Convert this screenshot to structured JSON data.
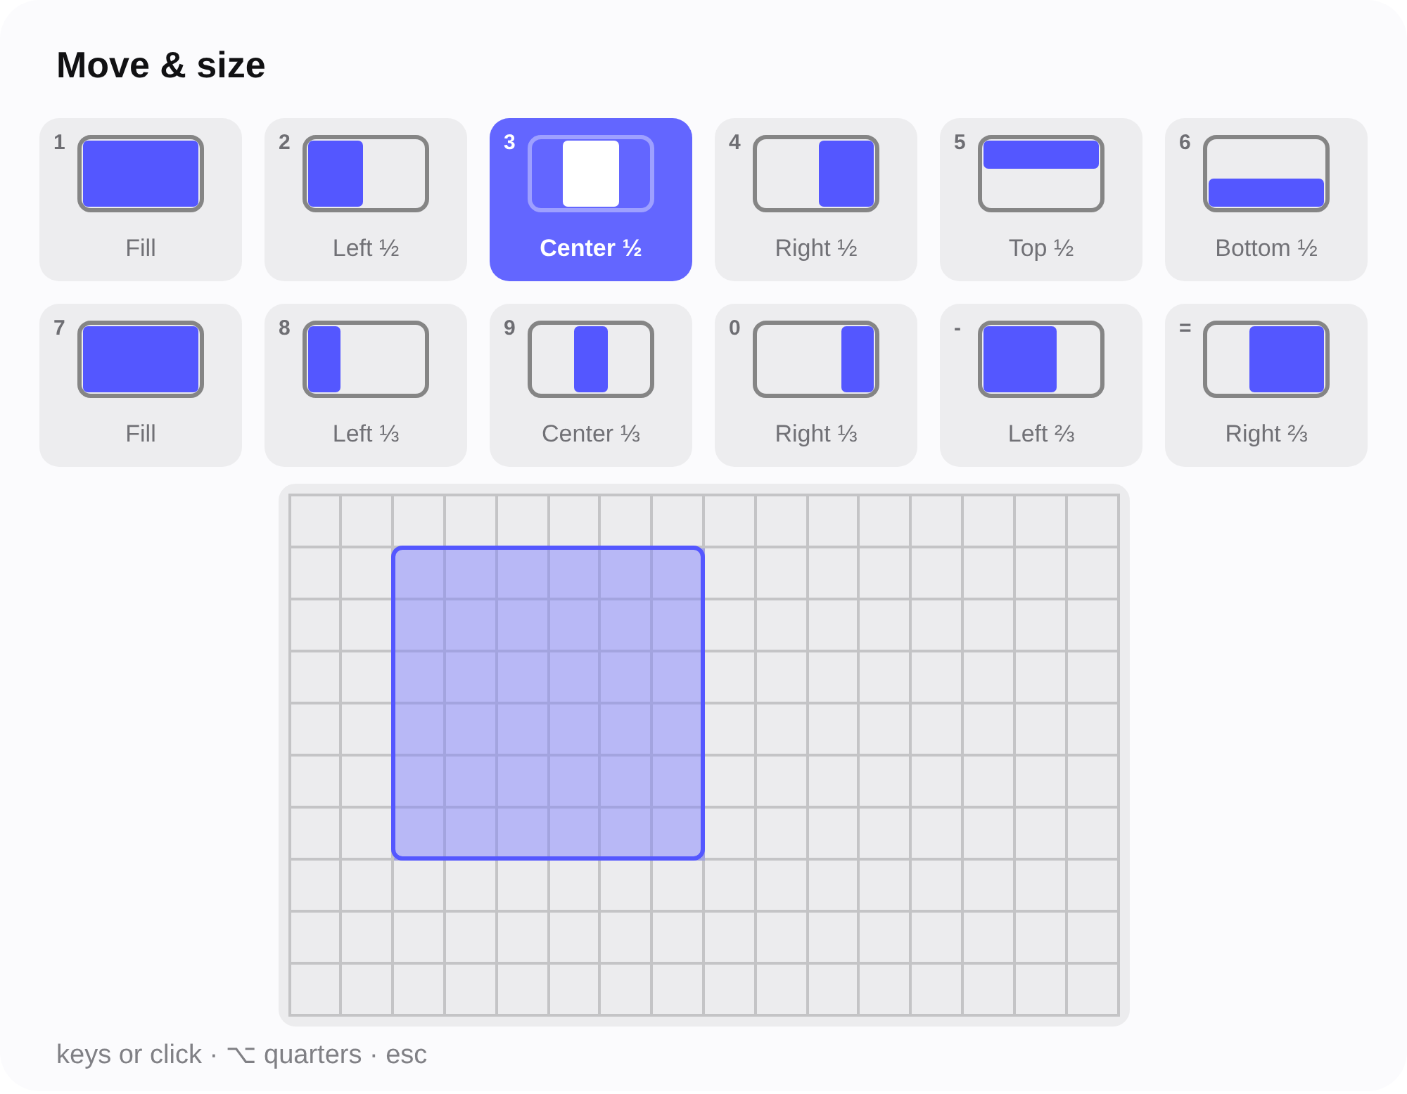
{
  "title": "Move & size",
  "tiles": [
    {
      "key": "1",
      "label": "Fill",
      "kind": "fill",
      "selected": false
    },
    {
      "key": "2",
      "label": "Left ½",
      "kind": "left_half",
      "selected": false
    },
    {
      "key": "3",
      "label": "Center ½",
      "kind": "center_half",
      "selected": true
    },
    {
      "key": "4",
      "label": "Right ½",
      "kind": "right_half",
      "selected": false
    },
    {
      "key": "5",
      "label": "Top ½",
      "kind": "top_half",
      "selected": false
    },
    {
      "key": "6",
      "label": "Bottom ½",
      "kind": "bottom_half",
      "selected": false
    },
    {
      "key": "7",
      "label": "Fill",
      "kind": "fill",
      "selected": false
    },
    {
      "key": "8",
      "label": "Left ⅓",
      "kind": "left_third",
      "selected": false
    },
    {
      "key": "9",
      "label": "Center ⅓",
      "kind": "center_third",
      "selected": false
    },
    {
      "key": "0",
      "label": "Right ⅓",
      "kind": "right_third",
      "selected": false
    },
    {
      "key": "-",
      "label": "Left ⅔",
      "kind": "left_two_thirds",
      "selected": false
    },
    {
      "key": "=",
      "label": "Right ⅔",
      "kind": "right_two_thirds",
      "selected": false
    }
  ],
  "grid": {
    "rows": [
      {
        "cells": [
          {
            "selected": false
          },
          {
            "selected": false
          },
          {
            "selected": false
          },
          {
            "selected": false
          },
          {
            "selected": false
          },
          {
            "selected": false
          },
          {
            "selected": false
          },
          {
            "selected": false
          },
          {
            "selected": false
          },
          {
            "selected": false
          },
          {
            "selected": false
          },
          {
            "selected": false
          },
          {
            "selected": false
          },
          {
            "selected": false
          },
          {
            "selected": false
          },
          {
            "selected": false
          }
        ]
      },
      {
        "cells": [
          {
            "selected": false
          },
          {
            "selected": false
          },
          {
            "selected": true
          },
          {
            "selected": true
          },
          {
            "selected": true
          },
          {
            "selected": true
          },
          {
            "selected": true
          },
          {
            "selected": true
          },
          {
            "selected": false
          },
          {
            "selected": false
          },
          {
            "selected": false
          },
          {
            "selected": false
          },
          {
            "selected": false
          },
          {
            "selected": false
          },
          {
            "selected": false
          },
          {
            "selected": false
          }
        ]
      },
      {
        "cells": [
          {
            "selected": false
          },
          {
            "selected": false
          },
          {
            "selected": true
          },
          {
            "selected": true
          },
          {
            "selected": true
          },
          {
            "selected": true
          },
          {
            "selected": true
          },
          {
            "selected": true
          },
          {
            "selected": false
          },
          {
            "selected": false
          },
          {
            "selected": false
          },
          {
            "selected": false
          },
          {
            "selected": false
          },
          {
            "selected": false
          },
          {
            "selected": false
          },
          {
            "selected": false
          }
        ]
      },
      {
        "cells": [
          {
            "selected": false
          },
          {
            "selected": false
          },
          {
            "selected": true
          },
          {
            "selected": true
          },
          {
            "selected": true
          },
          {
            "selected": true
          },
          {
            "selected": true
          },
          {
            "selected": true
          },
          {
            "selected": false
          },
          {
            "selected": false
          },
          {
            "selected": false
          },
          {
            "selected": false
          },
          {
            "selected": false
          },
          {
            "selected": false
          },
          {
            "selected": false
          },
          {
            "selected": false
          }
        ]
      },
      {
        "cells": [
          {
            "selected": false
          },
          {
            "selected": false
          },
          {
            "selected": true
          },
          {
            "selected": true
          },
          {
            "selected": true
          },
          {
            "selected": true
          },
          {
            "selected": true
          },
          {
            "selected": true
          },
          {
            "selected": false
          },
          {
            "selected": false
          },
          {
            "selected": false
          },
          {
            "selected": false
          },
          {
            "selected": false
          },
          {
            "selected": false
          },
          {
            "selected": false
          },
          {
            "selected": false
          }
        ]
      },
      {
        "cells": [
          {
            "selected": false
          },
          {
            "selected": false
          },
          {
            "selected": true
          },
          {
            "selected": true
          },
          {
            "selected": true
          },
          {
            "selected": true
          },
          {
            "selected": true
          },
          {
            "selected": true
          },
          {
            "selected": false
          },
          {
            "selected": false
          },
          {
            "selected": false
          },
          {
            "selected": false
          },
          {
            "selected": false
          },
          {
            "selected": false
          },
          {
            "selected": false
          },
          {
            "selected": false
          }
        ]
      },
      {
        "cells": [
          {
            "selected": false
          },
          {
            "selected": false
          },
          {
            "selected": true
          },
          {
            "selected": true
          },
          {
            "selected": true
          },
          {
            "selected": true
          },
          {
            "selected": true
          },
          {
            "selected": true
          },
          {
            "selected": false
          },
          {
            "selected": false
          },
          {
            "selected": false
          },
          {
            "selected": false
          },
          {
            "selected": false
          },
          {
            "selected": false
          },
          {
            "selected": false
          },
          {
            "selected": false
          }
        ]
      },
      {
        "cells": [
          {
            "selected": false
          },
          {
            "selected": false
          },
          {
            "selected": false
          },
          {
            "selected": false
          },
          {
            "selected": false
          },
          {
            "selected": false
          },
          {
            "selected": false
          },
          {
            "selected": false
          },
          {
            "selected": false
          },
          {
            "selected": false
          },
          {
            "selected": false
          },
          {
            "selected": false
          },
          {
            "selected": false
          },
          {
            "selected": false
          },
          {
            "selected": false
          },
          {
            "selected": false
          }
        ]
      },
      {
        "cells": [
          {
            "selected": false
          },
          {
            "selected": false
          },
          {
            "selected": false
          },
          {
            "selected": false
          },
          {
            "selected": false
          },
          {
            "selected": false
          },
          {
            "selected": false
          },
          {
            "selected": false
          },
          {
            "selected": false
          },
          {
            "selected": false
          },
          {
            "selected": false
          },
          {
            "selected": false
          },
          {
            "selected": false
          },
          {
            "selected": false
          },
          {
            "selected": false
          },
          {
            "selected": false
          }
        ]
      },
      {
        "cells": [
          {
            "selected": false
          },
          {
            "selected": false
          },
          {
            "selected": false
          },
          {
            "selected": false
          },
          {
            "selected": false
          },
          {
            "selected": false
          },
          {
            "selected": false
          },
          {
            "selected": false
          },
          {
            "selected": false
          },
          {
            "selected": false
          },
          {
            "selected": false
          },
          {
            "selected": false
          },
          {
            "selected": false
          },
          {
            "selected": false
          },
          {
            "selected": false
          },
          {
            "selected": false
          }
        ]
      }
    ]
  },
  "footer": "keys or click · ⌥ quarters · esc"
}
